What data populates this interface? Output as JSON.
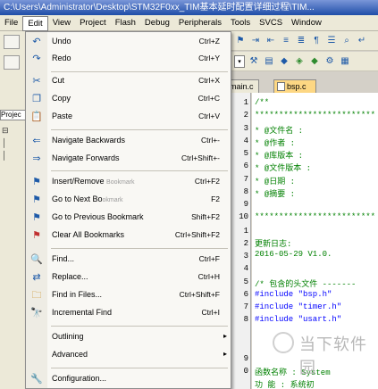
{
  "window": {
    "title": "C:\\Users\\Administrator\\Desktop\\STM32F0xx_TIM基本延时配置详细过程\\TIM..."
  },
  "menubar": {
    "items": [
      "File",
      "Edit",
      "View",
      "Project",
      "Flash",
      "Debug",
      "Peripherals",
      "Tools",
      "SVCS",
      "Window"
    ]
  },
  "sidebar": {
    "project_label": "Projec"
  },
  "edit_menu": {
    "items": [
      {
        "label": "Undo",
        "shortcut": "Ctrl+Z",
        "icon": "undo-icon",
        "glyph": "↶"
      },
      {
        "label": "Redo",
        "shortcut": "Ctrl+Y",
        "icon": "redo-icon",
        "glyph": "↷"
      },
      {
        "label": "Cut",
        "shortcut": "Ctrl+X",
        "icon": "scissors-icon",
        "glyph": "✂"
      },
      {
        "label": "Copy",
        "shortcut": "Ctrl+C",
        "icon": "copy-icon",
        "glyph": "❐"
      },
      {
        "label": "Paste",
        "shortcut": "Ctrl+V",
        "icon": "paste-icon",
        "glyph": "📋"
      },
      {
        "label": "Navigate Backwards",
        "shortcut": "Ctrl+-",
        "icon": "arrow-left-icon",
        "glyph": "⇐"
      },
      {
        "label": "Navigate Forwards",
        "shortcut": "Ctrl+Shift+-",
        "icon": "arrow-right-icon",
        "glyph": "⇒"
      },
      {
        "label": "Insert/Remove",
        "label_ghost": "Bookmark",
        "shortcut": "Ctrl+F2",
        "icon": "bookmark-icon",
        "glyph": "⚑"
      },
      {
        "label": "Go to Next Bo",
        "label_ghost": "okmark",
        "shortcut": "F2",
        "icon": "bookmark-next-icon",
        "glyph": "⚑"
      },
      {
        "label": "Go to Previous Bookmark",
        "shortcut": "Shift+F2",
        "icon": "bookmark-prev-icon",
        "glyph": "⚑"
      },
      {
        "label": "Clear All Bookmarks",
        "shortcut": "Ctrl+Shift+F2",
        "icon": "bookmark-clear-icon",
        "glyph": "⚑"
      },
      {
        "label": "Find...",
        "shortcut": "Ctrl+F",
        "icon": "find-icon",
        "glyph": "🔍"
      },
      {
        "label": "Replace...",
        "shortcut": "Ctrl+H",
        "icon": "replace-icon",
        "glyph": "⇄"
      },
      {
        "label": "Find in Files...",
        "shortcut": "Ctrl+Shift+F",
        "icon": "find-in-files-icon",
        "glyph": "🗀"
      },
      {
        "label": "Incremental Find",
        "shortcut": "Ctrl+I",
        "icon": "incremental-find-icon",
        "glyph": "🔭"
      },
      {
        "label": "Outlining",
        "shortcut": "",
        "icon": "",
        "glyph": "",
        "submenu": "▸"
      },
      {
        "label": "Advanced",
        "shortcut": "",
        "icon": "",
        "glyph": "",
        "submenu": "▸"
      },
      {
        "label": "Configuration...",
        "shortcut": "",
        "icon": "wrench-icon",
        "glyph": "🔧"
      }
    ]
  },
  "tabs": {
    "main": "main.c",
    "bsp": "bsp.c"
  },
  "editor": {
    "line_numbers": [
      "1",
      "2",
      "3",
      "4",
      "5",
      "6",
      "7",
      "8",
      "9",
      "10",
      "1",
      "2",
      "3",
      "4",
      "5",
      "6",
      "7",
      "8",
      "9",
      "0"
    ],
    "lines": [
      "/**",
      "  *************************",
      "  * @文件名     :",
      "  * @作者       :",
      "  * @库版本     :",
      "  * @文件版本   :",
      "  * @日期       :",
      "  * @摘要       :",
      "",
      "  *************************",
      "  更新日志:",
      "  2016-05-29 V1.0.",
      "",
      "/* 包含的头文件 -------",
      "#include \"bsp.h\"",
      "#include \"timer.h\"",
      "#include \"usart.h\"",
      "",
      "函数名称 : System",
      "功    能 : 系统初"
    ]
  },
  "watermark": {
    "text": "当下软件园"
  },
  "colors": {
    "menu_bg": "#f9f8f4",
    "icon_blue": "#1e5aa8",
    "comment_green": "#008000",
    "keyword_blue": "#0000ff",
    "tab_active": "#fdd783"
  }
}
